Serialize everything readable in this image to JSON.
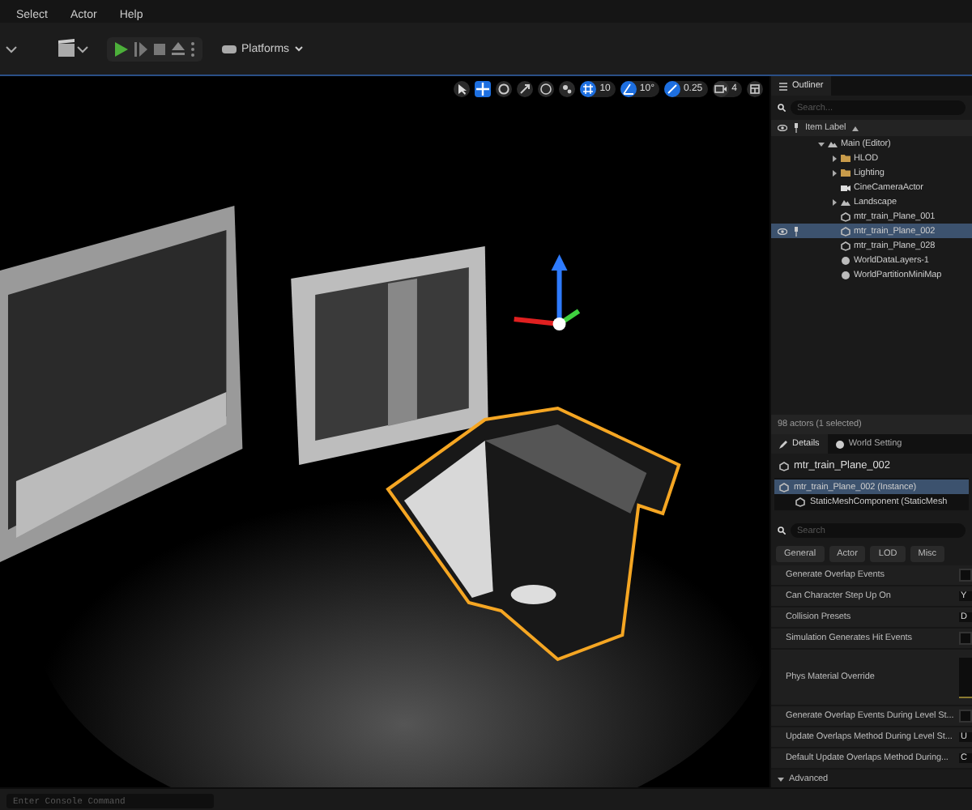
{
  "menu": [
    "Select",
    "Actor",
    "Help"
  ],
  "toolbar": {
    "platforms": "Platforms"
  },
  "viewport_toolbar": {
    "tools": [
      {
        "kind": "select",
        "selected": false
      },
      {
        "kind": "move",
        "selected": true
      },
      {
        "kind": "rotate",
        "selected": false
      },
      {
        "kind": "scale",
        "selected": false
      }
    ],
    "snaps": [
      {
        "kind": "grid",
        "on": true,
        "value": "10"
      },
      {
        "kind": "angle",
        "on": true,
        "value": "10°"
      },
      {
        "kind": "scale",
        "on": true,
        "value": "0.25"
      },
      {
        "kind": "camera",
        "on": false,
        "value": "4"
      }
    ]
  },
  "outliner": {
    "tab": "Outliner",
    "search": {
      "placeholder": "Search..."
    },
    "column": "Item Label",
    "tree": [
      {
        "label": "Main (Editor)",
        "kind": "level",
        "expanded": true,
        "selected": false,
        "children": [
          {
            "label": "HLOD",
            "kind": "folder",
            "expanded": false,
            "selected": false
          },
          {
            "label": "Lighting",
            "kind": "folder",
            "expanded": false,
            "selected": false
          },
          {
            "label": "CineCameraActor",
            "kind": "camera",
            "selected": false
          },
          {
            "label": "Landscape",
            "kind": "level",
            "expanded": false,
            "selected": false
          },
          {
            "label": "mtr_train_Plane_001",
            "kind": "mesh",
            "selected": false
          },
          {
            "label": "mtr_train_Plane_002",
            "kind": "mesh",
            "selected": true
          },
          {
            "label": "mtr_train_Plane_028",
            "kind": "mesh",
            "selected": false
          },
          {
            "label": "WorldDataLayers-1",
            "kind": "info",
            "selected": false
          },
          {
            "label": "WorldPartitionMiniMap",
            "kind": "info",
            "selected": false
          }
        ]
      }
    ],
    "status": "98 actors (1 selected)"
  },
  "details": {
    "tabs": [
      {
        "label": "Details",
        "selected": true
      },
      {
        "label": "World Setting",
        "selected": false
      }
    ],
    "actor": "mtr_train_Plane_002",
    "components": [
      {
        "label": "mtr_train_Plane_002 (Instance)",
        "selected": true,
        "children": [
          {
            "label": "StaticMeshComponent (StaticMesh",
            "selected": false
          }
        ]
      }
    ],
    "search": {
      "placeholder": "Search"
    },
    "filters": [
      "General",
      "Actor",
      "LOD",
      "Misc"
    ],
    "properties": [
      {
        "label": "Generate Overlap Events",
        "kind": "checkbox",
        "checked": false
      },
      {
        "label": "Can Character Step Up On",
        "kind": "dropdown",
        "value": "Y"
      },
      {
        "label": "Collision Presets",
        "kind": "dropdown",
        "value": "D"
      },
      {
        "label": "Simulation Generates Hit Events",
        "kind": "checkbox",
        "checked": false
      },
      {
        "label": "Phys Material Override",
        "kind": "asset"
      },
      {
        "label": "Generate Overlap Events During Level St...",
        "kind": "checkbox",
        "checked": false
      },
      {
        "label": "Update Overlaps Method During Level St...",
        "kind": "dropdown",
        "value": "U"
      },
      {
        "label": "Default Update Overlaps Method During...",
        "kind": "dropdown",
        "value": "C"
      }
    ],
    "section": {
      "label": "Advanced",
      "expanded": true
    }
  },
  "console": {
    "placeholder": "Enter Console Command"
  }
}
